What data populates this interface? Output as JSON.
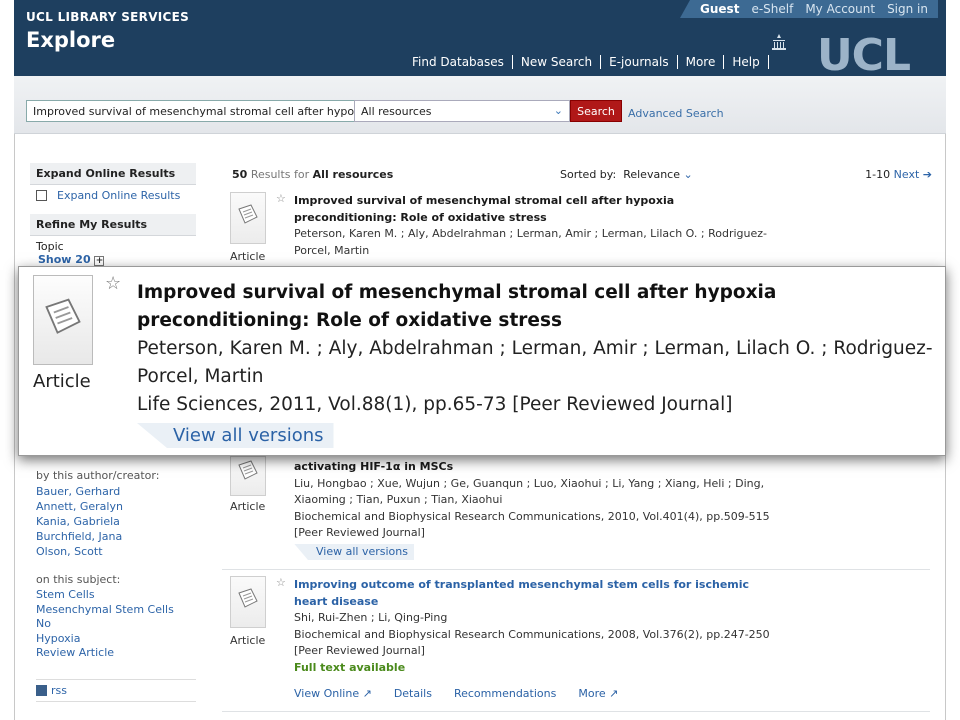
{
  "header": {
    "brand": "UCL LIBRARY SERVICES",
    "title": "Explore",
    "logo_text": "UCL",
    "top_links": [
      "Guest",
      "e-Shelf",
      "My Account",
      "Sign in"
    ],
    "nav": [
      "Find Databases",
      "New Search",
      "E-journals",
      "More",
      "Help"
    ]
  },
  "search": {
    "query": "Improved survival of mesenchymal stromal cell after hypo",
    "scope": "All resources",
    "button": "Search",
    "advanced": "Advanced Search"
  },
  "sidebar": {
    "expand_heading": "Expand Online Results",
    "expand_option": "Expand Online Results",
    "refine_heading": "Refine My Results",
    "topic_label": "Topic",
    "show_label": "Show 20",
    "author_label": "by this author/creator:",
    "authors": [
      "Bauer, Gerhard",
      "Annett, Geralyn",
      "Kania, Gabriela",
      "Burchfield, Jana",
      "Olson, Scott"
    ],
    "subject_label": "on this subject:",
    "subjects": [
      "Stem Cells",
      "Mesenchymal Stem Cells",
      "No",
      "Hypoxia",
      "Review Article"
    ],
    "rss": "rss"
  },
  "results_header": {
    "count": "50",
    "count_text": "Results for",
    "scope": "All resources",
    "sorted_label": "Sorted by:",
    "sorted_value": "Relevance",
    "range": "1-10",
    "next": "Next"
  },
  "results": [
    {
      "type": "Article",
      "title_line1": "Improved survival of mesenchymal stromal cell after hypoxia",
      "title_line2": "preconditioning: Role of oxidative stress",
      "authors_line1": "Peterson, Karen M. ; Aly, Abdelrahman ; Lerman, Amir ; Lerman, Lilach O. ; Rodriguez-",
      "authors_line2": "Porcel, Martin"
    },
    {
      "type": "Article",
      "title_line2": "activating HIF-1α in MSCs",
      "authors_line1": "Liu, Hongbao ; Xue, Wujun ; Ge, Guanqun ; Luo, Xiaohui ; Li, Yang ; Xiang, Heli ; Ding,",
      "authors_line2": "Xiaoming ; Tian, Puxun ; Tian, Xiaohui",
      "source": "Biochemical and Biophysical Research Communications, 2010, Vol.401(4), pp.509-515",
      "review": "[Peer Reviewed Journal]",
      "versions": "View all versions"
    },
    {
      "type": "Article",
      "title_line1": "Improving outcome of transplanted mesenchymal stem cells for ischemic",
      "title_line2": "heart disease",
      "authors_line1": "Shi, Rui-Zhen ; Li, Qing-Ping",
      "source": "Biochemical and Biophysical Research Communications, 2008, Vol.376(2), pp.247-250",
      "review": "[Peer Reviewed Journal]",
      "fulltext": "Full text available",
      "actions": [
        "View Online",
        "Details",
        "Recommendations",
        "More"
      ]
    }
  ],
  "zoom": {
    "type": "Article",
    "title_line1": "Improved survival of mesenchymal stromal cell after hypoxia",
    "title_line2": "preconditioning: Role of oxidative stress",
    "authors_line1": "Peterson, Karen M. ; Aly, Abdelrahman ; Lerman, Amir ; Lerman, Lilach O. ; Rodriguez-",
    "authors_line2": "Porcel, Martin",
    "source": "Life Sciences, 2011, Vol.88(1), pp.65-73 [Peer Reviewed Journal]",
    "versions": "View all versions"
  },
  "colors": {
    "header_bg": "#1e3f5f",
    "search_button": "#b01818",
    "link": "#2b62a6",
    "fulltext": "#4a8a1b"
  }
}
